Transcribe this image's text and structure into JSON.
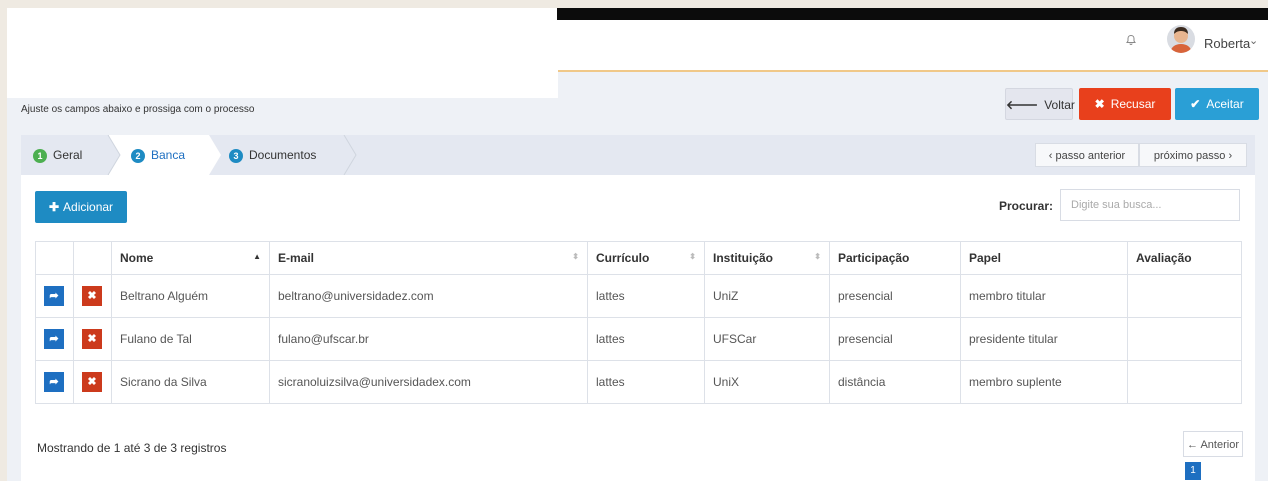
{
  "header": {
    "user_name": "Roberta",
    "bell_icon": "bell-icon",
    "caret_icon": "chevron-down-icon"
  },
  "page": {
    "subtitle": "Ajuste os campos abaixo e prossiga com o processo"
  },
  "actions": {
    "back_label": "Voltar",
    "reject_label": "Recusar",
    "accept_label": "Aceitar"
  },
  "steps": [
    {
      "num": "1",
      "label": "Geral",
      "color": "#4caf50"
    },
    {
      "num": "2",
      "label": "Banca",
      "color": "#1e8bc3"
    },
    {
      "num": "3",
      "label": "Documentos",
      "color": "#1e8bc3"
    }
  ],
  "step_nav": {
    "prev": "‹ passo anterior",
    "next": "próximo passo ›"
  },
  "toolbar": {
    "add_label": "Adicionar",
    "search_label": "Procurar:",
    "search_placeholder": "Digite sua busca..."
  },
  "table": {
    "columns": [
      "Nome",
      "E-mail",
      "Currículo",
      "Instituição",
      "Participação",
      "Papel",
      "Avaliação"
    ],
    "rows": [
      {
        "nome": "Beltrano Alguém",
        "email": "beltrano@universidadez.com",
        "curriculo": "lattes",
        "instituicao": "UniZ",
        "participacao": "presencial",
        "papel": "membro titular",
        "avaliacao": ""
      },
      {
        "nome": "Fulano de Tal",
        "email": "fulano@ufscar.br",
        "curriculo": "lattes",
        "instituicao": "UFSCar",
        "participacao": "presencial",
        "papel": "presidente titular",
        "avaliacao": ""
      },
      {
        "nome": "Sicrano da Silva",
        "email": "sicranoluizsilva@universidadex.com",
        "curriculo": "lattes",
        "instituicao": "UniX",
        "participacao": "distância",
        "papel": "membro suplente",
        "avaliacao": ""
      }
    ]
  },
  "footer": {
    "info": "Mostrando de 1 até 3 de 3 registros",
    "prev_label": "← Anterior",
    "current_page": "1"
  },
  "colors": {
    "accent": "#2a9fd6",
    "danger": "#e8401c",
    "edit": "#1e6fc1"
  }
}
